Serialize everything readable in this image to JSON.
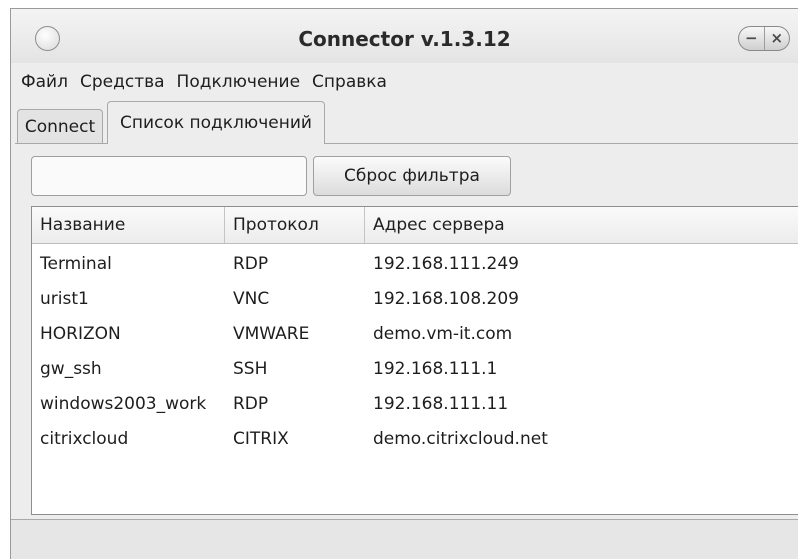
{
  "window": {
    "title": "Connector v.1.3.12",
    "minimize_symbol": "−",
    "close_symbol": "×"
  },
  "menu": {
    "items": [
      "Файл",
      "Средства",
      "Подключение",
      "Справка"
    ]
  },
  "tabs": [
    {
      "label": "Connect",
      "active": false
    },
    {
      "label": "Список подключений",
      "active": true
    }
  ],
  "search": {
    "icon": "search-icon",
    "value": "",
    "placeholder": ""
  },
  "reset_button": {
    "label": "Сброс фильтра"
  },
  "table": {
    "columns": [
      "Название",
      "Протокол",
      "Адрес сервера"
    ],
    "rows": [
      [
        "Terminal",
        "RDP",
        "192.168.111.249"
      ],
      [
        "urist1",
        "VNC",
        "192.168.108.209"
      ],
      [
        "HORIZON",
        "VMWARE",
        "demo.vm-it.com"
      ],
      [
        "gw_ssh",
        "SSH",
        "192.168.111.1"
      ],
      [
        "windows2003_work",
        "RDP",
        "192.168.111.11"
      ],
      [
        "citrixcloud",
        "CITRIX",
        "demo.citrixcloud.net"
      ]
    ]
  }
}
